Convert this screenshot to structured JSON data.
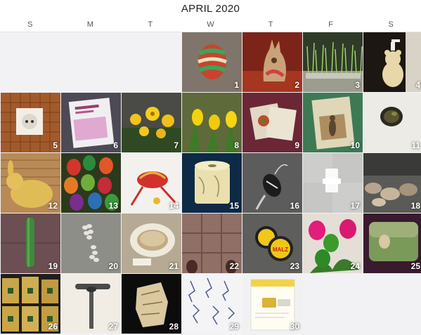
{
  "header": {
    "title": "APRIL 2020"
  },
  "weekdays": [
    "S",
    "M",
    "T",
    "W",
    "T",
    "F",
    "S"
  ],
  "days": [
    {
      "num": "1",
      "subject": "striped-egg"
    },
    {
      "num": "2",
      "subject": "chocolate-bunny"
    },
    {
      "num": "3",
      "subject": "grass-tray"
    },
    {
      "num": "4",
      "subject": "bear-soap-dispenser"
    },
    {
      "num": "5",
      "subject": "wall-outlet"
    },
    {
      "num": "6",
      "subject": "seed-packet"
    },
    {
      "num": "7",
      "subject": "yellow-flowers"
    },
    {
      "num": "8",
      "subject": "tulips"
    },
    {
      "num": "9",
      "subject": "card"
    },
    {
      "num": "10",
      "subject": "book-cover"
    },
    {
      "num": "11",
      "subject": "hole-in-wall"
    },
    {
      "num": "12",
      "subject": "knitted-bunny"
    },
    {
      "num": "13",
      "subject": "colored-eggs"
    },
    {
      "num": "14",
      "subject": "red-ribbon-gift"
    },
    {
      "num": "15",
      "subject": "toilet-roll"
    },
    {
      "num": "16",
      "subject": "egg-ornament"
    },
    {
      "num": "17",
      "subject": "white-hook"
    },
    {
      "num": "18",
      "subject": "stones"
    },
    {
      "num": "19",
      "subject": "green-bottle"
    },
    {
      "num": "20",
      "subject": "shoe-print"
    },
    {
      "num": "21",
      "subject": "coffee-cup"
    },
    {
      "num": "22",
      "subject": "shoes-on-tiles"
    },
    {
      "num": "23",
      "subject": "malz-bottle-caps"
    },
    {
      "num": "24",
      "subject": "eggs-on-plant"
    },
    {
      "num": "25",
      "subject": "framed-photo"
    },
    {
      "num": "26",
      "subject": "coffee-bags"
    },
    {
      "num": "27",
      "subject": "door-handle"
    },
    {
      "num": "28",
      "subject": "crumpled-bag"
    },
    {
      "num": "29",
      "subject": "hand-drawings"
    },
    {
      "num": "30",
      "subject": "sim-card"
    }
  ],
  "sim_card_text": "Klein, aber eine deine neue SIM",
  "malz_text": "MALZ"
}
